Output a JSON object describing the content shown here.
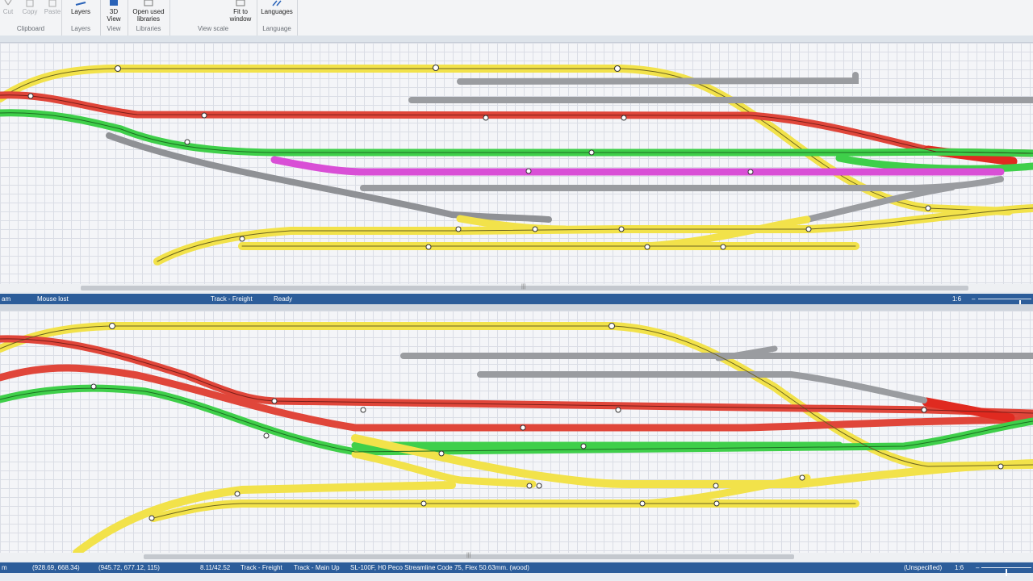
{
  "ribbon": {
    "groups": [
      {
        "label": "Clipboard",
        "buttons": [
          "Cut",
          "Copy",
          "Paste"
        ]
      },
      {
        "label": "Layers",
        "buttons": [
          "Layers"
        ]
      },
      {
        "label": "View",
        "buttons": [
          "3D View"
        ]
      },
      {
        "label": "Libraries",
        "buttons": [
          "Open used libraries"
        ]
      },
      {
        "label": "View scale",
        "buttons": [
          "Fit to window"
        ]
      },
      {
        "label": "Language",
        "buttons": [
          "Languages"
        ]
      }
    ]
  },
  "top_status": {
    "left_fragment": "am",
    "mouse": "Mouse lost",
    "track": "Track - Freight",
    "state": "Ready",
    "scale": "1:6",
    "zoom_level": 0.8
  },
  "bottom_status": {
    "left_fragment": "m",
    "coord1": "(928.69, 668.34)",
    "coord2": "(945.72, 677.12, 115)",
    "dims": "8.11/42.52",
    "track": "Track - Freight",
    "track2": "Track - Main Up",
    "part": "SL-100F, H0 Peco Streamline Code 75, Flex 50.63mm. (wood)",
    "layer": "(Unspecified)",
    "scale": "1:6",
    "zoom_level": 0.5
  },
  "colors": {
    "yellow": "#f2e24a",
    "red": "#e0463a",
    "green": "#3fcf4a",
    "gray": "#9a9ca0",
    "magenta": "#d94fd6",
    "status_bar": "#2c5d9a"
  }
}
